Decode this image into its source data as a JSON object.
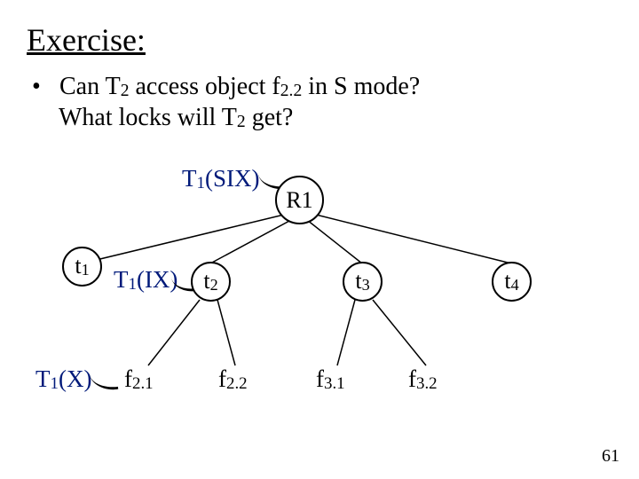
{
  "title": "Exercise:",
  "question_l1_pre": "Can T",
  "question_l1_sub1": "2",
  "question_l1_mid": " access object f",
  "question_l1_sub2": "2.2",
  "question_l1_post": " in S mode?",
  "question_l2_pre": "What locks will T",
  "question_l2_sub": "2",
  "question_l2_post": " get?",
  "nodes": {
    "R1": "R1",
    "t1": "t",
    "t1_sub": "1",
    "t2": "t",
    "t2_sub": "2",
    "t3": "t",
    "t3_sub": "3",
    "t4": "t",
    "t4_sub": "4"
  },
  "labels": {
    "six_pre": "T",
    "six_sub": "1",
    "six_post": "(SIX)",
    "ix_pre": "T",
    "ix_sub": "1",
    "ix_post": "(IX)",
    "x_pre": "T",
    "x_sub": "1",
    "x_post": "(X)"
  },
  "leaves": {
    "f21": "f",
    "f21_sub": "2.1",
    "f22": "f",
    "f22_sub": "2.2",
    "f31": "f",
    "f31_sub": "3.1",
    "f32": "f",
    "f32_sub": "3.2"
  },
  "page_number": "61"
}
